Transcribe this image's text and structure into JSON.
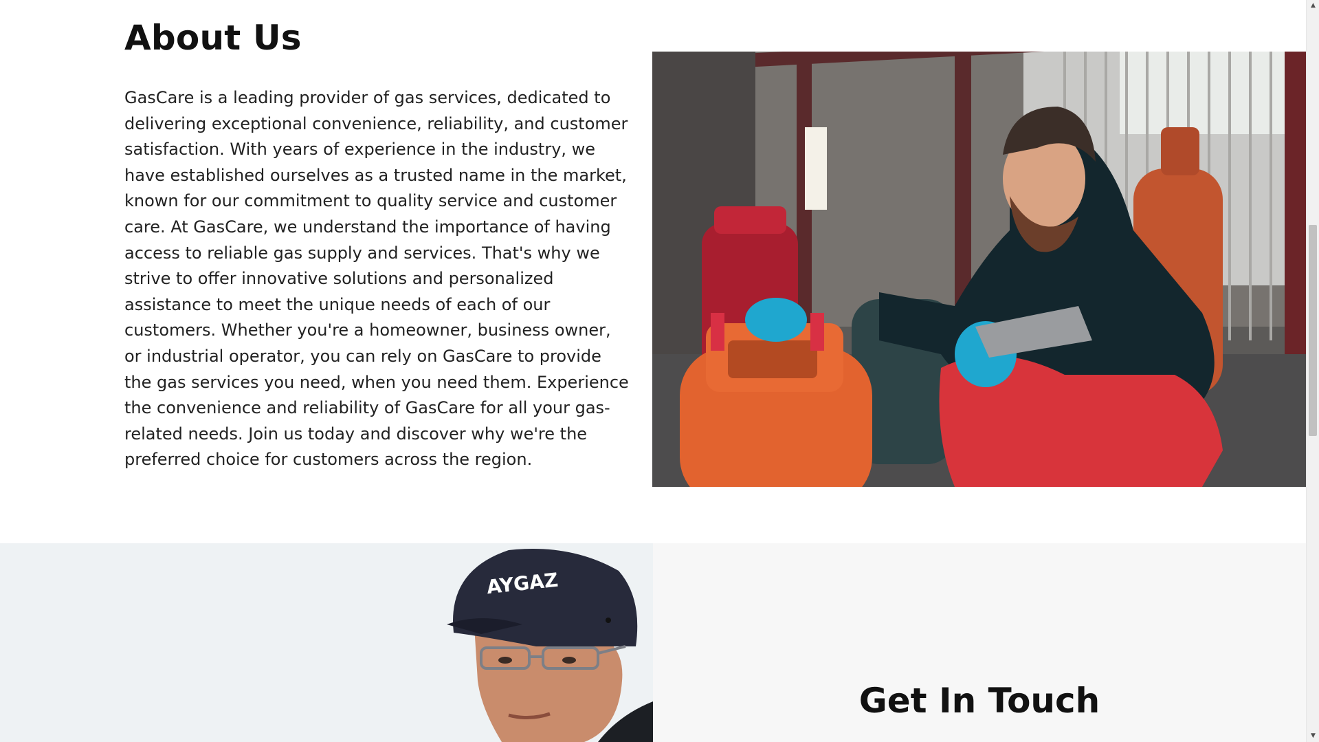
{
  "about": {
    "title": "About Us",
    "body": "GasCare is a leading provider of gas services, dedicated to delivering exceptional convenience, reliability, and customer satisfaction. With years of experience in the industry, we have established ourselves as a trusted name in the market, known for our commitment to quality service and customer care. At GasCare, we understand the importance of having access to reliable gas supply and services. That's why we strive to offer innovative solutions and personalized assistance to meet the unique needs of each of our customers. Whether you're a homeowner, business owner, or industrial operator, you can rely on GasCare to provide the gas services you need, when you need them. Experience the convenience and reliability of GasCare for all your gas-related needs. Join us today and discover why we're the preferred choice for customers across the region."
  },
  "contact": {
    "title": "Get In Touch",
    "cap_logo": "AYGAZ"
  },
  "scrollbar": {
    "up_arrow": "▲",
    "down_arrow": "▼"
  },
  "colors": {
    "background": "#ffffff",
    "contact_panel": "#f7f7f7",
    "heading": "#111111",
    "body_text": "#222222"
  }
}
